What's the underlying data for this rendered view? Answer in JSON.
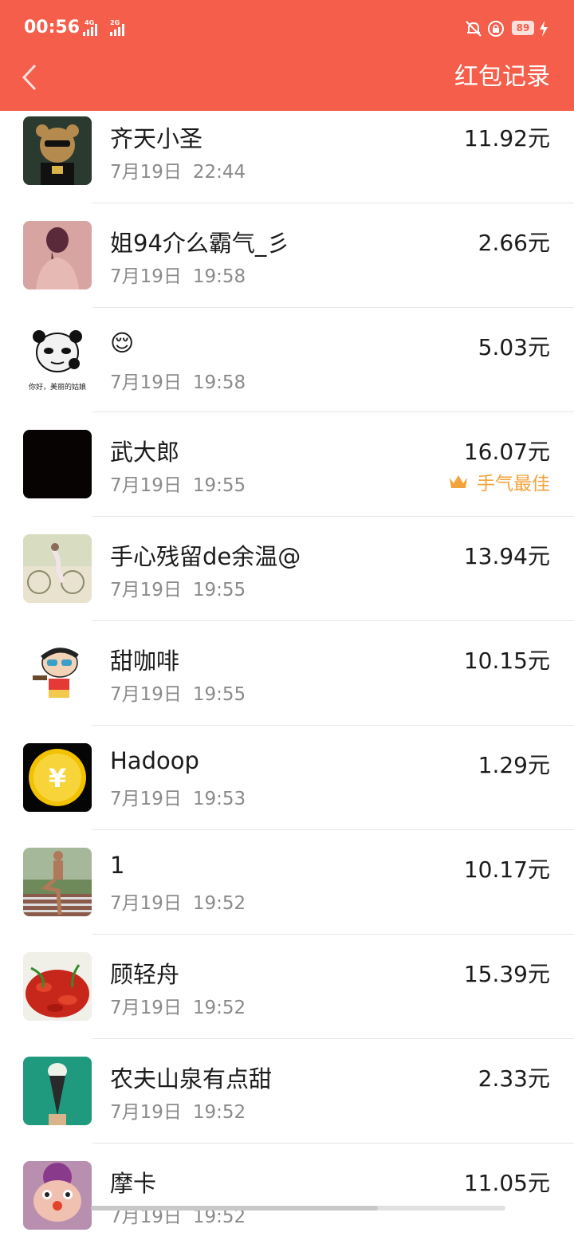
{
  "status_bar": {
    "time": "00:56",
    "network1": "4G",
    "network2": "2G",
    "battery": "89",
    "icons": [
      "signal-icon",
      "mute-bell-icon",
      "lock-rotation-icon",
      "battery-icon",
      "charging-icon"
    ]
  },
  "header": {
    "back_icon": "chevron-left-icon",
    "title": "红包记录"
  },
  "colors": {
    "header_bg": "#f45e4a",
    "best_luck": "#f2a33a"
  },
  "records": [
    {
      "name": "齐天小圣",
      "date": "7月19日",
      "time": "22:44",
      "amount": "11.92元"
    },
    {
      "name": "姐94介么霸气_彡",
      "date": "7月19日",
      "time": "19:58",
      "amount": "2.66元"
    },
    {
      "name": "😌",
      "date": "7月19日",
      "time": "19:58",
      "amount": "5.03元"
    },
    {
      "name": "武大郎",
      "date": "7月19日",
      "time": "19:55",
      "amount": "16.07元",
      "best": "手气最佳"
    },
    {
      "name": "手心残留de余温@",
      "date": "7月19日",
      "time": "19:55",
      "amount": "13.94元"
    },
    {
      "name": "甜咖啡",
      "date": "7月19日",
      "time": "19:55",
      "amount": "10.15元"
    },
    {
      "name": "Hadoop",
      "date": "7月19日",
      "time": "19:53",
      "amount": "1.29元"
    },
    {
      "name": "1",
      "date": "7月19日",
      "time": "19:52",
      "amount": "10.17元"
    },
    {
      "name": "顾轻舟",
      "date": "7月19日",
      "time": "19:52",
      "amount": "15.39元"
    },
    {
      "name": "农夫山泉有点甜",
      "date": "7月19日",
      "time": "19:52",
      "amount": "2.33元"
    },
    {
      "name": "摩卡",
      "date": "7月19日",
      "time": "19:52",
      "amount": "11.05元"
    }
  ],
  "avatar_text": {
    "panda_caption": "你好，美丽的姑娘",
    "coin_symbol": "¥"
  }
}
